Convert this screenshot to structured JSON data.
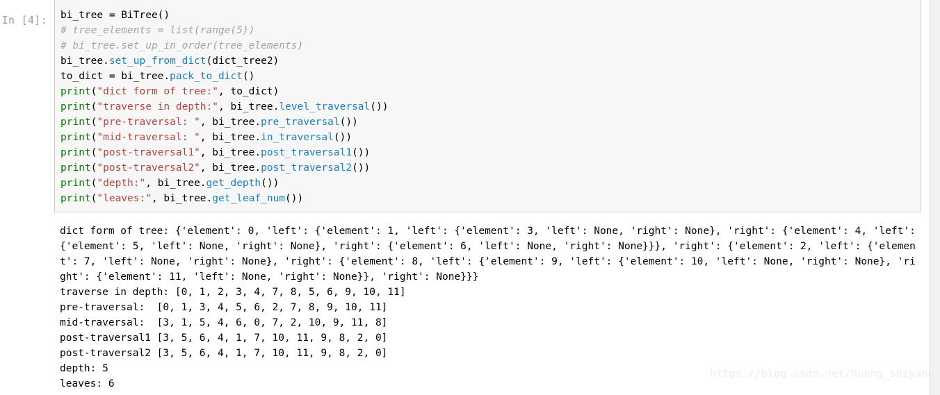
{
  "cell": {
    "prompt_label": "In [4]:",
    "execution_count": "4",
    "code_lines": [
      [
        {
          "t": "bi_tree = BiTree()",
          "c": "plain"
        }
      ],
      [
        {
          "t": "# tree_elements = list(range(5))",
          "c": "comment"
        }
      ],
      [
        {
          "t": "# bi_tree.set_up_in_order(tree_elements)",
          "c": "comment"
        }
      ],
      [
        {
          "t": "bi_tree.",
          "c": "plain"
        },
        {
          "t": "set_up_from_dict",
          "c": "method"
        },
        {
          "t": "(dict_tree2)",
          "c": "plain"
        }
      ],
      [
        {
          "t": "to_dict = bi_tree.",
          "c": "plain"
        },
        {
          "t": "pack_to_dict",
          "c": "method"
        },
        {
          "t": "()",
          "c": "plain"
        }
      ],
      [
        {
          "t": "print",
          "c": "builtin"
        },
        {
          "t": "(",
          "c": "plain"
        },
        {
          "t": "\"dict form of tree:\"",
          "c": "string"
        },
        {
          "t": ", to_dict)",
          "c": "plain"
        }
      ],
      [
        {
          "t": "print",
          "c": "builtin"
        },
        {
          "t": "(",
          "c": "plain"
        },
        {
          "t": "\"traverse in depth:\"",
          "c": "string"
        },
        {
          "t": ", bi_tree.",
          "c": "plain"
        },
        {
          "t": "level_traversal",
          "c": "method"
        },
        {
          "t": "())",
          "c": "plain"
        }
      ],
      [
        {
          "t": "print",
          "c": "builtin"
        },
        {
          "t": "(",
          "c": "plain"
        },
        {
          "t": "\"pre-traversal: \"",
          "c": "string"
        },
        {
          "t": ", bi_tree.",
          "c": "plain"
        },
        {
          "t": "pre_traversal",
          "c": "method"
        },
        {
          "t": "())",
          "c": "plain"
        }
      ],
      [
        {
          "t": "print",
          "c": "builtin"
        },
        {
          "t": "(",
          "c": "plain"
        },
        {
          "t": "\"mid-traversal: \"",
          "c": "string"
        },
        {
          "t": ", bi_tree.",
          "c": "plain"
        },
        {
          "t": "in_traversal",
          "c": "method"
        },
        {
          "t": "())",
          "c": "plain"
        }
      ],
      [
        {
          "t": "print",
          "c": "builtin"
        },
        {
          "t": "(",
          "c": "plain"
        },
        {
          "t": "\"post-traversal1\"",
          "c": "string"
        },
        {
          "t": ", bi_tree.",
          "c": "plain"
        },
        {
          "t": "post_traversal1",
          "c": "method"
        },
        {
          "t": "())",
          "c": "plain"
        }
      ],
      [
        {
          "t": "print",
          "c": "builtin"
        },
        {
          "t": "(",
          "c": "plain"
        },
        {
          "t": "\"post-traversal2\"",
          "c": "string"
        },
        {
          "t": ", bi_tree.",
          "c": "plain"
        },
        {
          "t": "post_traversal2",
          "c": "method"
        },
        {
          "t": "())",
          "c": "plain"
        }
      ],
      [
        {
          "t": "print",
          "c": "builtin"
        },
        {
          "t": "(",
          "c": "plain"
        },
        {
          "t": "\"depth:\"",
          "c": "string"
        },
        {
          "t": ", bi_tree.",
          "c": "plain"
        },
        {
          "t": "get_depth",
          "c": "method"
        },
        {
          "t": "())",
          "c": "plain"
        }
      ],
      [
        {
          "t": "print",
          "c": "builtin"
        },
        {
          "t": "(",
          "c": "plain"
        },
        {
          "t": "\"leaves:\"",
          "c": "string"
        },
        {
          "t": ", bi_tree.",
          "c": "plain"
        },
        {
          "t": "get_leaf_num",
          "c": "method"
        },
        {
          "t": "())",
          "c": "plain"
        }
      ]
    ],
    "output_lines": [
      "dict form of tree: {'element': 0, 'left': {'element': 1, 'left': {'element': 3, 'left': None, 'right': None}, 'right': {'element': 4, 'left':",
      "{'element': 5, 'left': None, 'right': None}, 'right': {'element': 6, 'left': None, 'right': None}}}, 'right': {'element': 2, 'left': {'elemen",
      "t': 7, 'left': None, 'right': None}, 'right': {'element': 8, 'left': {'element': 9, 'left': {'element': 10, 'left': None, 'right': None}, 'ri",
      "ght': {'element': 11, 'left': None, 'right': None}}, 'right': None}}}",
      "traverse in depth: [0, 1, 2, 3, 4, 7, 8, 5, 6, 9, 10, 11]",
      "pre-traversal:  [0, 1, 3, 4, 5, 6, 2, 7, 8, 9, 10, 11]",
      "mid-traversal:  [3, 1, 5, 4, 6, 0, 7, 2, 10, 9, 11, 8]",
      "post-traversal1 [3, 5, 6, 4, 1, 7, 10, 11, 9, 8, 2, 0]",
      "post-traversal2 [3, 5, 6, 4, 1, 7, 10, 11, 9, 8, 2, 0]",
      "depth: 5",
      "leaves: 6"
    ]
  },
  "watermark": {
    "text": "https://blog.csdn.net/huang_shiyang"
  },
  "colors": {
    "cell_background": "#f7f7f7",
    "cell_border": "#cfcfcf",
    "prompt_text": "#9b9b9b",
    "comment": "#9aa7b1",
    "builtin": "#008000",
    "string": "#b4453c",
    "method": "#1a7fc1",
    "output_text": "#000000",
    "watermark": "#ececec",
    "page_background": "#ffffff"
  }
}
